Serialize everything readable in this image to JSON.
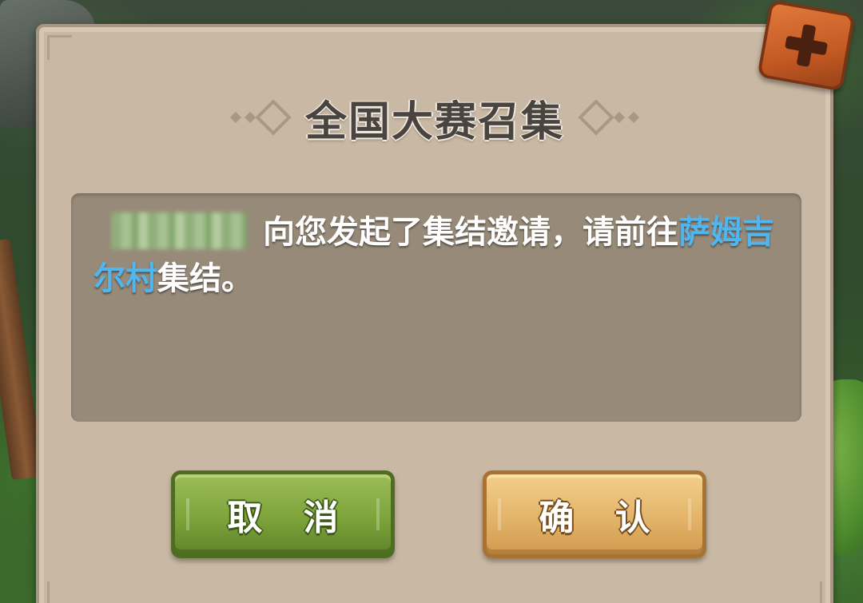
{
  "dialog": {
    "title": "全国大赛召集",
    "message_prefix": "向您发起了集结邀请，请前往",
    "place_name": "萨姆吉尔村",
    "message_suffix": "集结。",
    "cancel_label": "取 消",
    "confirm_label": "确 认"
  },
  "colors": {
    "panel": "#c9b8a3",
    "message_bg": "#978a79",
    "place_highlight": "#4fb6f0",
    "cancel_button": "#7da43a",
    "confirm_button": "#e3b46a",
    "close_button": "#c45a24"
  },
  "icons": {
    "close": "close-icon"
  }
}
